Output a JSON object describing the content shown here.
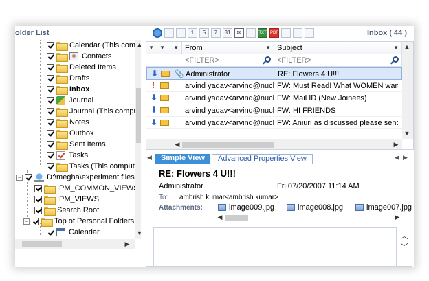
{
  "left_pane": {
    "title": "older List",
    "tree": [
      {
        "label": "Calendar (This com",
        "icon": "calendar-icon"
      },
      {
        "label": "Contacts",
        "icon": "contacts-icon"
      },
      {
        "label": "Deleted Items",
        "icon": "folder-icon"
      },
      {
        "label": "Drafts",
        "icon": "folder-icon"
      },
      {
        "label": "Inbox",
        "icon": "folder-icon",
        "bold": true
      },
      {
        "label": "Journal",
        "icon": "journal-icon"
      },
      {
        "label": "Journal (This compu",
        "icon": "folder-icon"
      },
      {
        "label": "Notes",
        "icon": "folder-icon"
      },
      {
        "label": "Outbox",
        "icon": "folder-icon"
      },
      {
        "label": "Sent Items",
        "icon": "folder-icon"
      },
      {
        "label": "Tasks",
        "icon": "tasks-icon"
      },
      {
        "label": "Tasks (This comput",
        "icon": "folder-icon"
      },
      {
        "label": "D:\\megha\\experiment files'",
        "icon": "drive-icon"
      },
      {
        "label": "IPM_COMMON_VIEWS",
        "icon": "folder-icon"
      },
      {
        "label": "IPM_VIEWS",
        "icon": "folder-icon"
      },
      {
        "label": "Search Root",
        "icon": "folder-icon"
      },
      {
        "label": "Top of Personal Folders",
        "icon": "folder-icon"
      },
      {
        "label": "Calendar",
        "icon": "calendar-icon"
      }
    ]
  },
  "toolbar": {
    "inbox_title": "Inbox ( 44 )",
    "buttons": [
      "refresh-icon",
      "filter-icon",
      "folder-view-icon",
      "day-1-icon",
      "day-5-icon",
      "day-7-icon",
      "day-31-icon",
      "mail-icon",
      "msg-export-icon",
      "txt-export-icon",
      "pdf-export-icon",
      "html-export-icon",
      "find-icon",
      "settings-icon"
    ],
    "day_labels": [
      "1",
      "5",
      "7",
      "31"
    ],
    "export_labels": [
      "TXT",
      "PDF"
    ]
  },
  "message_list": {
    "columns": {
      "from": "From",
      "subject": "Subject"
    },
    "filter_placeholder": "<FILTER>",
    "rows": [
      {
        "from": "Administrator",
        "subject": "RE: Flowers 4 U!!!",
        "flag": "down",
        "attachment": true
      },
      {
        "from": "arvind yadav<arvind@nucle...",
        "subject": "FW: Must Read! What WOMEN want?",
        "flag": "important",
        "attachment": false
      },
      {
        "from": "arvind yadav<arvind@nucle...",
        "subject": "FW: Mail ID (New Joinees)",
        "flag": "down",
        "attachment": false
      },
      {
        "from": "arvind yadav<arvind@nucle...",
        "subject": "FW: HI FRIENDS",
        "flag": "down",
        "attachment": false
      },
      {
        "from": "arvind yadav<arvind@nucle...",
        "subject": "FW: Aniuri as discussed please send t...",
        "flag": "down",
        "attachment": false
      }
    ]
  },
  "tabs": {
    "simple": "Simple View",
    "advanced": "Advanced Properties View"
  },
  "preview": {
    "subject": "RE: Flowers 4 U!!!",
    "from": "Administrator",
    "date": "Fri 07/20/2007 11:14 AM",
    "to_label": "To:",
    "to": "ambrish kumar<ambrish kumar>",
    "attachments_label": "Attachments:",
    "attachments": [
      "image009.jpg",
      "image008.jpg",
      "image007.jpg"
    ]
  }
}
